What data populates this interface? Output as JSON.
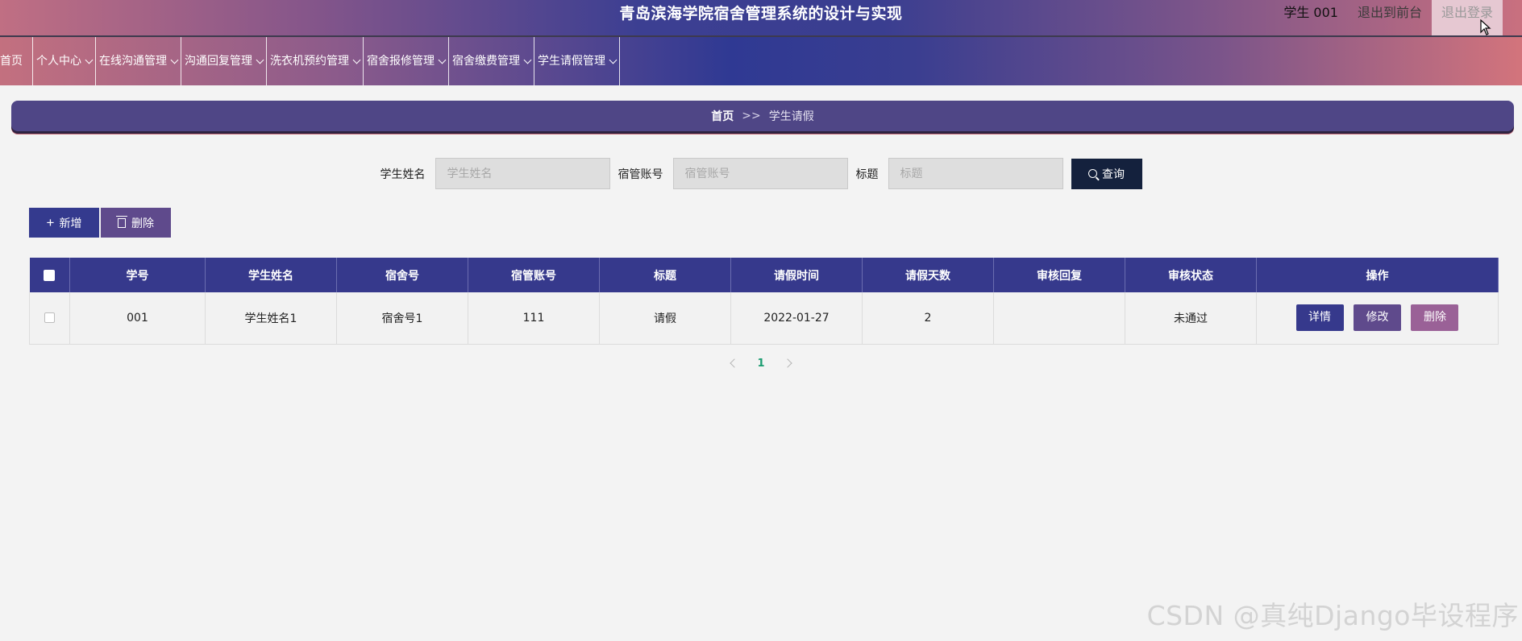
{
  "header": {
    "title": "青岛滨海学院宿舍管理系统的设计与实现",
    "user_name": "学生 001",
    "front_label": "退出到前台",
    "logout_label": "退出登录"
  },
  "nav": {
    "items": [
      {
        "label": "首页",
        "has_dropdown": false
      },
      {
        "label": "个人中心",
        "has_dropdown": true
      },
      {
        "label": "在线沟通管理",
        "has_dropdown": true
      },
      {
        "label": "沟通回复管理",
        "has_dropdown": true
      },
      {
        "label": "洗衣机预约管理",
        "has_dropdown": true
      },
      {
        "label": "宿舍报修管理",
        "has_dropdown": true
      },
      {
        "label": "宿舍缴费管理",
        "has_dropdown": true
      },
      {
        "label": "学生请假管理",
        "has_dropdown": true
      }
    ]
  },
  "breadcrumb": {
    "home": "首页",
    "separator": ">>",
    "current": "学生请假"
  },
  "search": {
    "fields": [
      {
        "label": "学生姓名",
        "placeholder": "学生姓名",
        "value": ""
      },
      {
        "label": "宿管账号",
        "placeholder": "宿管账号",
        "value": ""
      },
      {
        "label": "标题",
        "placeholder": "标题",
        "value": ""
      }
    ],
    "query_label": "查询"
  },
  "actions": {
    "add_label": "新增",
    "delete_label": "删除"
  },
  "table": {
    "columns": [
      "学号",
      "学生姓名",
      "宿舍号",
      "宿管账号",
      "标题",
      "请假时间",
      "请假天数",
      "审核回复",
      "审核状态",
      "操作"
    ],
    "rows": [
      {
        "student_no": "001",
        "student_name": "学生姓名1",
        "dorm_no": "宿舍号1",
        "manager_account": "111",
        "title": "请假",
        "leave_time": "2022-01-27",
        "leave_days": "2",
        "review_reply": "",
        "review_status": "未通过"
      }
    ],
    "row_actions": {
      "detail": "详情",
      "edit": "修改",
      "delete": "删除"
    }
  },
  "pagination": {
    "current_page": "1"
  },
  "watermark": "CSDN @真纯Django毕设程序",
  "colors": {
    "header_primary": "#3a3e90",
    "table_header": "#36398c",
    "query_button": "#14213d",
    "detail_button": "#36398c",
    "edit_button": "#5f4a8c",
    "delete_button": "#9a6197",
    "page_active": "#1a9c70"
  }
}
